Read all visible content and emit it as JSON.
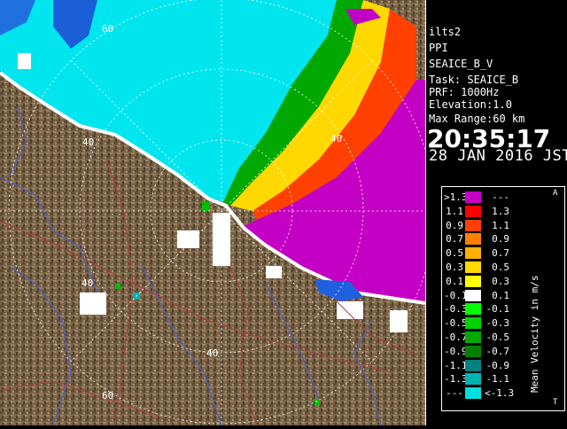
{
  "station": "ilts2",
  "product": "PPI",
  "task_id": "SEAICE_B_V",
  "task_line": "Task: SEAICE_B",
  "prf_line": "PRF: 1000Hz",
  "elevation_line": "Elevation:1.0",
  "range_line": "Max Range:60 km",
  "time": "20:35:17",
  "date": "28 JAN 2016 JST",
  "ring_labels": [
    "40",
    "60",
    "40",
    "40",
    "60",
    "40"
  ],
  "legend": {
    "unit": "Mean Velocity in m/s",
    "top_tag": "A",
    "bottom_tag": "T",
    "rows": [
      {
        "lo": ">1.3",
        "hi": "---",
        "color": "#c400c4"
      },
      {
        "lo": "1.1",
        "hi": "1.3",
        "color": "#ff0000"
      },
      {
        "lo": "0.9",
        "hi": "1.1",
        "color": "#ff4000"
      },
      {
        "lo": "0.7",
        "hi": "0.9",
        "color": "#ff8000"
      },
      {
        "lo": "0.5",
        "hi": "0.7",
        "color": "#ffb000"
      },
      {
        "lo": "0.3",
        "hi": "0.5",
        "color": "#ffd800"
      },
      {
        "lo": "0.1",
        "hi": "0.3",
        "color": "#ffff00"
      },
      {
        "lo": "-0.1",
        "hi": "0.1",
        "color": "#ffffff"
      },
      {
        "lo": "-0.3",
        "hi": "-0.1",
        "color": "#00ff00"
      },
      {
        "lo": "-0.5",
        "hi": "-0.3",
        "color": "#00d200"
      },
      {
        "lo": "-0.7",
        "hi": "-0.5",
        "color": "#00a800"
      },
      {
        "lo": "-0.9",
        "hi": "-0.7",
        "color": "#008000"
      },
      {
        "lo": "-1.1",
        "hi": "-0.9",
        "color": "#008080"
      },
      {
        "lo": "-1.3",
        "hi": "-1.1",
        "color": "#00b4b4"
      },
      {
        "lo": "---",
        "hi": "<-1.3",
        "color": "#00e0e0"
      }
    ]
  },
  "colors": {
    "terrain": "#7a6448",
    "terrain_dark": "#4e3e2a",
    "approaching": "#00e5ee",
    "receding": "#c400c4",
    "snow": "#ffffff",
    "rivers": "#5060c0",
    "roads": "#b04040"
  }
}
